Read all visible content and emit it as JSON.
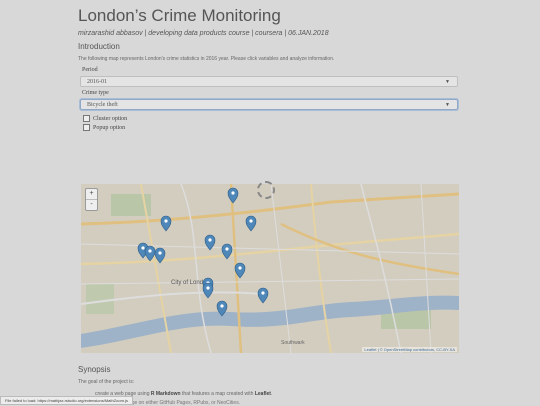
{
  "header": {
    "title": "London’s Crime Monitoring",
    "subtitle": "mirzarashid abbasov | developing data products course | coursera | 06.JAN.2018"
  },
  "intro": {
    "heading": "Introduction",
    "text": "The following map represents London's crime statistics in 2016 year. Please click variables and analyze information."
  },
  "controls": {
    "period_label": "Period",
    "period_value": "2016-01",
    "crime_label": "Crime type",
    "crime_value": "Bicycle theft",
    "cluster_label": "Cluster option",
    "popup_label": "Popup option"
  },
  "map": {
    "zoom_in": "+",
    "zoom_out": "-",
    "attribution_link": "Leaflet",
    "attribution_text": "| © OpenStreetMap contributors, CC-BY-SA",
    "markers_count": 15,
    "marker_color": "#4e87b8",
    "labels": [
      "City of London",
      "Southwark"
    ]
  },
  "synopsis": {
    "heading": "Synopsis",
    "text": "The goal of the project is:",
    "bullet1_pre": "create a web page using ",
    "bullet1_bold": "R Markdown",
    "bullet1_mid": " that features a map created with ",
    "bullet1_bold2": "Leaflet",
    "bullet1_end": ".",
    "bullet2": "host your webpage on either GitHub Pages, RPubs, or NeoCities."
  },
  "status": {
    "text": "File failed to load: https://mathjax.rstudio.org/extensions/MathZoom.js"
  }
}
